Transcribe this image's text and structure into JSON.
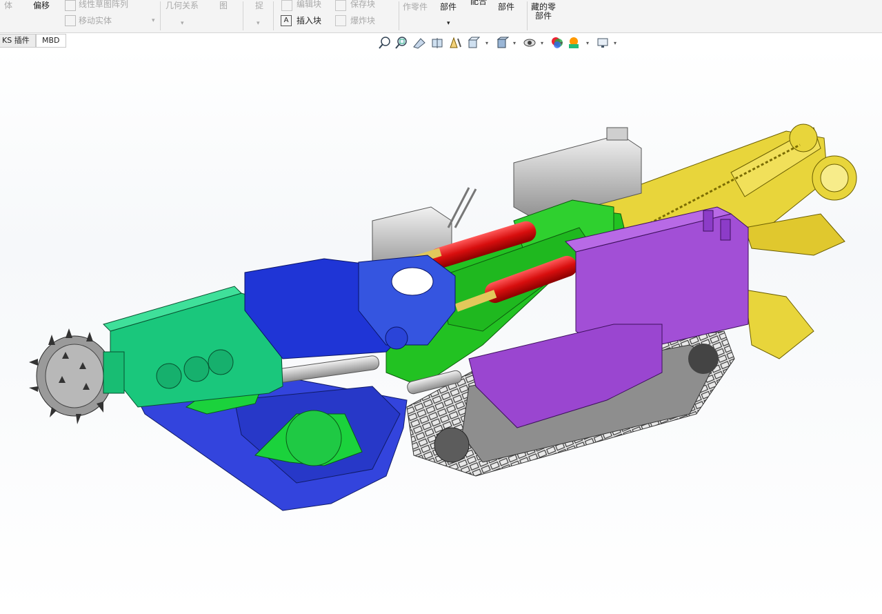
{
  "ribbon": {
    "groups": [
      {
        "lines": [
          "体"
        ],
        "enabled": false
      },
      {
        "lines": [
          "偏移"
        ],
        "enabled": true
      },
      {
        "lines": [
          "线性草图阵列",
          "移动实体"
        ],
        "enabled": false
      },
      {
        "lines": [
          "几何关系"
        ],
        "enabled": false
      },
      {
        "lines": [
          "图"
        ],
        "enabled": false
      },
      {
        "lines": [
          "捉"
        ],
        "enabled": false
      },
      {
        "lines": [
          "编辑块",
          "插入块"
        ],
        "enabled": true
      },
      {
        "lines": [
          "保存块",
          "爆炸块"
        ],
        "enabled": false
      },
      {
        "lines": [
          "作零件"
        ],
        "enabled": false
      },
      {
        "lines": [
          "部件"
        ],
        "enabled": true
      },
      {
        "lines": [
          "配合"
        ],
        "enabled": true
      },
      {
        "lines": [
          "部件"
        ],
        "enabled": true
      },
      {
        "lines": [
          "藏的零",
          "部件"
        ],
        "enabled": true
      }
    ],
    "labels": {
      "ti": "体",
      "pianyi": "偏移",
      "linear_pattern": "线性草图阵列",
      "move_body": "移动实体",
      "relations": "几何关系",
      "tu": "图",
      "zhuo": "捉",
      "edit_block": "编辑块",
      "insert_block": "插入块",
      "save_block": "保存块",
      "explode_block": "爆炸块",
      "zuo_lingjian": "作零件",
      "bujian1": "部件",
      "peihe": "配合",
      "bujian2": "部件",
      "hidden_parts_1": "藏的零",
      "hidden_parts_2": "部件"
    }
  },
  "tabs": [
    {
      "label": "KS 插件",
      "active": true
    },
    {
      "label": "MBD",
      "active": false
    }
  ],
  "heads_up_toolbar": {
    "icons": [
      "zoom-to-fit-icon",
      "zoom-to-area-icon",
      "previous-view-icon",
      "section-view-icon",
      "dynamic-annotation-icon",
      "view-orientation-icon",
      "display-style-icon",
      "hide-show-items-icon",
      "edit-appearance-icon",
      "apply-scene-icon",
      "view-settings-icon"
    ]
  },
  "colors": {
    "cutter_head": "#9a9a9a",
    "cutter_boom": "#19c27a",
    "gearbox": "#1f35d6",
    "swivel": "#3555e0",
    "frame": "#20c020",
    "cylinder": "#e41a1a",
    "power_pack": "#a24fd6",
    "rear_conveyor": "#e7d23a",
    "loading_apron": "#3344dd",
    "crawler": "#8f8f8f",
    "electrical_box": "#b9b9b9"
  }
}
